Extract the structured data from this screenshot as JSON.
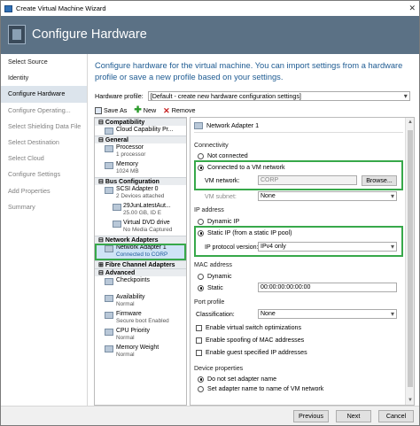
{
  "window": {
    "title": "Create Virtual Machine Wizard"
  },
  "banner": {
    "title": "Configure Hardware"
  },
  "steps": [
    {
      "label": "Select Source",
      "state": "done"
    },
    {
      "label": "Identity",
      "state": "done"
    },
    {
      "label": "Configure Hardware",
      "state": "current"
    },
    {
      "label": "Configure Operating...",
      "state": "disabled"
    },
    {
      "label": "Select Shielding Data File",
      "state": "disabled"
    },
    {
      "label": "Select Destination",
      "state": "disabled"
    },
    {
      "label": "Select Cloud",
      "state": "disabled"
    },
    {
      "label": "Configure Settings",
      "state": "disabled"
    },
    {
      "label": "Add Properties",
      "state": "disabled"
    },
    {
      "label": "Summary",
      "state": "disabled"
    }
  ],
  "intro": "Configure hardware for the virtual machine. You can import settings from a hardware profile or save a new profile based on your settings.",
  "profile": {
    "label": "Hardware profile:",
    "value": "[Default - create new hardware configuration settings]"
  },
  "toolbar": {
    "save_as": "Save As",
    "new": "New",
    "remove": "Remove"
  },
  "tree": {
    "compatibility": "Compatibility",
    "cloud_capability": "Cloud Capability Pr...",
    "general": "General",
    "processor": "Processor",
    "processor_sub": "1 processor",
    "memory": "Memory",
    "memory_sub": "1024 MB",
    "bus_configuration": "Bus Configuration",
    "scsi": "SCSI Adapter 0",
    "scsi_sub": "2 Devices attached",
    "vhd": "29JunLatestAut...",
    "vhd_sub": "25.00 GB, ID E",
    "dvd": "Virtual DVD drive",
    "dvd_sub": "No Media Captured",
    "network_adapters": "Network Adapters",
    "nic": "Network Adapter 1",
    "nic_sub": "Connected to CORP",
    "fibre": "Fibre Channel Adapters",
    "advanced": "Advanced",
    "checkpoints": "Checkpoints",
    "availability": "Availability",
    "availability_sub": "Normal",
    "firmware": "Firmware",
    "firmware_sub": "Secure boot Enabled",
    "cpu_priority": "CPU Priority",
    "cpu_priority_sub": "Normal",
    "memory_weight": "Memory Weight",
    "memory_weight_sub": "Normal"
  },
  "panel": {
    "header": "Network Adapter 1",
    "connectivity": "Connectivity",
    "not_connected": "Not connected",
    "connected_vm_network": "Connected to a VM network",
    "vm_network_label": "VM network:",
    "vm_network_value": "CORP",
    "browse": "Browse...",
    "vm_subnet_label": "VM subnet:",
    "vm_subnet_value": "None",
    "ip_address": "IP address",
    "dynamic_ip": "Dynamic IP",
    "static_ip": "Static IP (from a static IP pool)",
    "ip_protocol_label": "IP protocol version:",
    "ip_protocol_value": "IPv4 only",
    "mac_address": "MAC address",
    "mac_dynamic": "Dynamic",
    "mac_static": "Static",
    "mac_value": "00:00:00:00:00:00",
    "port_profile": "Port profile",
    "classification_label": "Classification:",
    "classification_value": "None",
    "enable_vsi": "Enable virtual switch optimizations",
    "enable_spoofing": "Enable spoofing of MAC addresses",
    "enable_guest_ip": "Enable guest specified IP addresses",
    "device_properties": "Device properties",
    "no_set_name": "Do not set adapter name",
    "set_name": "Set adapter name to name of VM network"
  },
  "footer": {
    "previous": "Previous",
    "next": "Next",
    "cancel": "Cancel"
  }
}
